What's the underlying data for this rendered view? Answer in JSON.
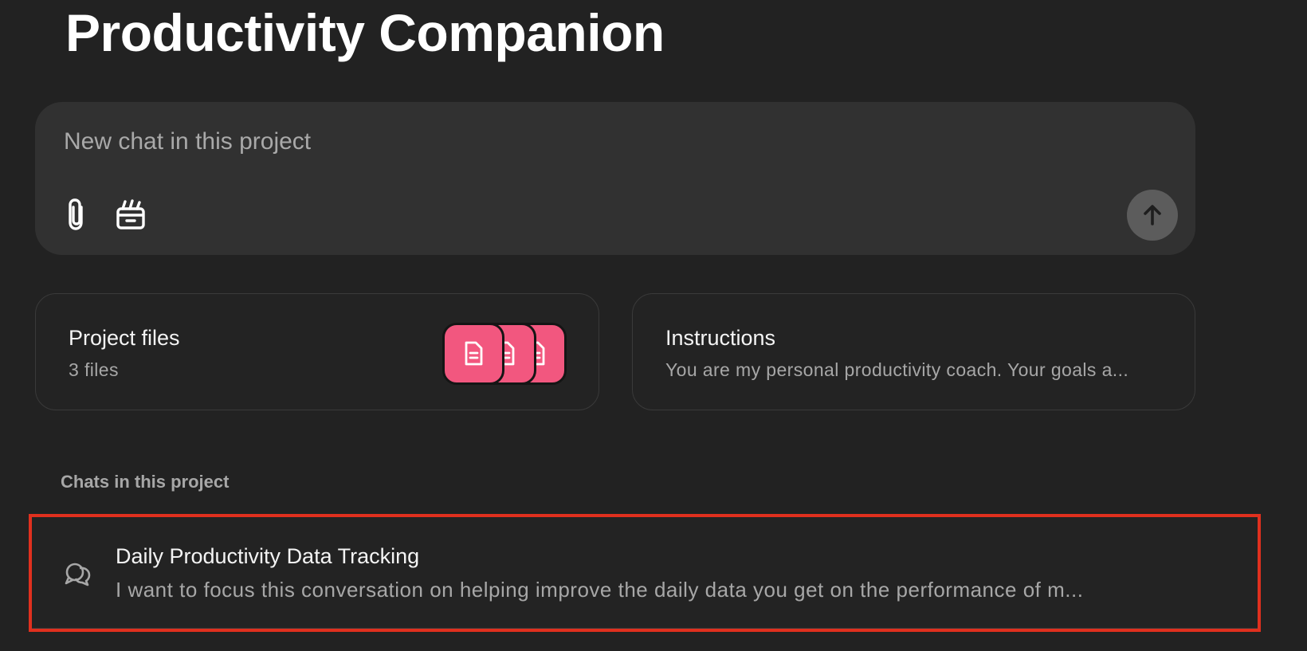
{
  "page": {
    "title": "Productivity Companion"
  },
  "composer": {
    "placeholder": "New chat in this project",
    "icons": [
      "paperclip-icon",
      "google-drive-icon",
      "arrow-up-icon"
    ]
  },
  "project_files": {
    "title": "Project files",
    "count_label": "3 files",
    "file_icon": "document-icon",
    "file_color": "#f2577f"
  },
  "instructions": {
    "title": "Instructions",
    "preview": "You are my personal productivity coach. Your goals a..."
  },
  "chats_section": {
    "label": "Chats in this project",
    "items": [
      {
        "title": "Daily Productivity Data Tracking",
        "preview": "I want to focus this conversation on helping improve the daily data you get on the performance of m...",
        "icon": "chat-bubbles-icon"
      }
    ]
  },
  "colors": {
    "background": "#222222",
    "composer": "#313131",
    "highlight_border": "#e0301e",
    "send_button": "#5c5c5c"
  }
}
